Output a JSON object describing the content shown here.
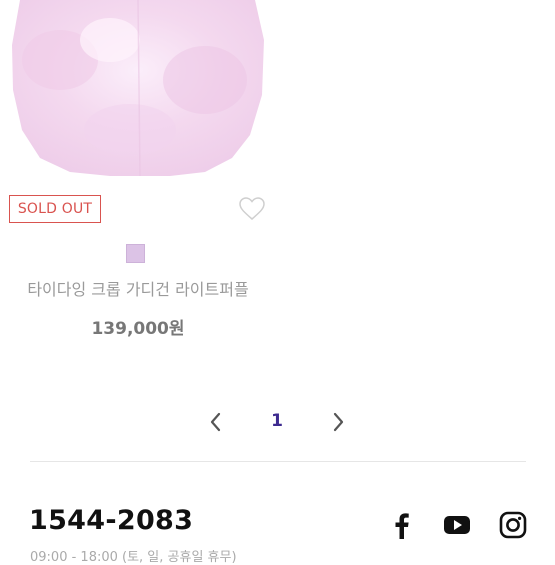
{
  "product": {
    "badge": "SOLD OUT",
    "name": "타이다잉 크롭 가디건 라이트퍼플",
    "price": "139,000원",
    "swatch_color": "#dcc3e6"
  },
  "pagination": {
    "current_page": "1"
  },
  "footer": {
    "phone": "1544-2083",
    "hours": "09:00 - 18:00 (토, 일, 공휴일 휴무)"
  },
  "icons": {
    "wishlist": "heart-outline-icon",
    "prev": "chevron-left-icon",
    "next": "chevron-right-icon",
    "facebook": "facebook-icon",
    "youtube": "youtube-icon",
    "instagram": "instagram-icon"
  },
  "colors": {
    "sold_out": "#d9534f",
    "page_active": "#3d2a8f"
  }
}
